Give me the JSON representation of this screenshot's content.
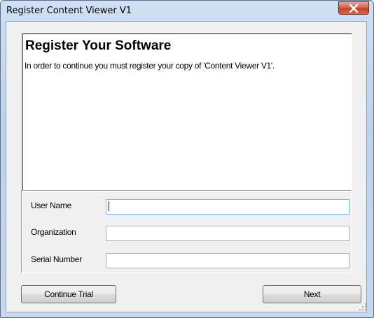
{
  "window": {
    "title": "Register Content Viewer V1",
    "close_icon": "close-icon"
  },
  "header": {
    "heading": "Register Your Software",
    "message": "In order to continue you must register your copy of 'Content Viewer V1'."
  },
  "form": {
    "user_name_label": "User Name",
    "user_name_value": "",
    "organization_label": "Organization",
    "organization_value": "",
    "serial_number_label": "Serial Number",
    "serial_number_value": ""
  },
  "buttons": {
    "continue_trial": "Continue Trial",
    "next": "Next"
  },
  "colors": {
    "close_button": "#c2432b",
    "focused_border": "#7eb4ea"
  }
}
